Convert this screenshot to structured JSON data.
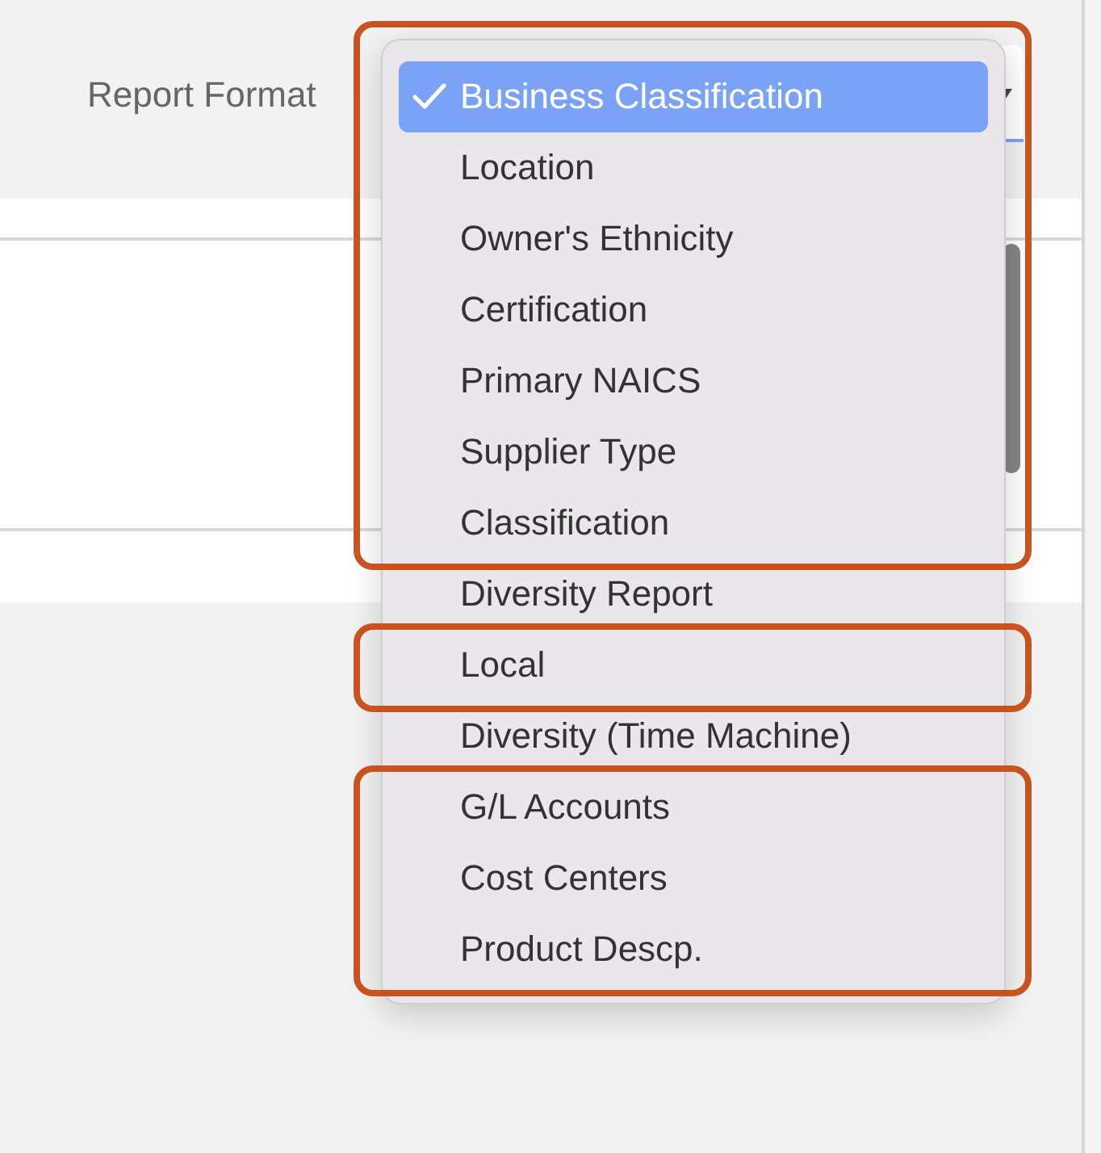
{
  "report_format": {
    "label": "Report Format"
  },
  "menu": {
    "groups": [
      {
        "highlighted": true,
        "items": [
          {
            "label": "Business Classification",
            "selected": true
          },
          {
            "label": "Location",
            "selected": false
          },
          {
            "label": "Owner's Ethnicity",
            "selected": false
          },
          {
            "label": "Certification",
            "selected": false
          },
          {
            "label": "Primary NAICS",
            "selected": false
          },
          {
            "label": "Supplier Type",
            "selected": false
          },
          {
            "label": "Classification",
            "selected": false
          }
        ]
      },
      {
        "highlighted": false,
        "items": [
          {
            "label": "Diversity Report",
            "selected": false
          }
        ]
      },
      {
        "highlighted": true,
        "items": [
          {
            "label": "Local",
            "selected": false
          }
        ]
      },
      {
        "highlighted": false,
        "items": [
          {
            "label": "Diversity (Time Machine)",
            "selected": false
          }
        ]
      },
      {
        "highlighted": true,
        "items": [
          {
            "label": "G/L Accounts",
            "selected": false
          },
          {
            "label": "Cost Centers",
            "selected": false
          },
          {
            "label": "Product Descp.",
            "selected": false
          }
        ]
      }
    ]
  }
}
